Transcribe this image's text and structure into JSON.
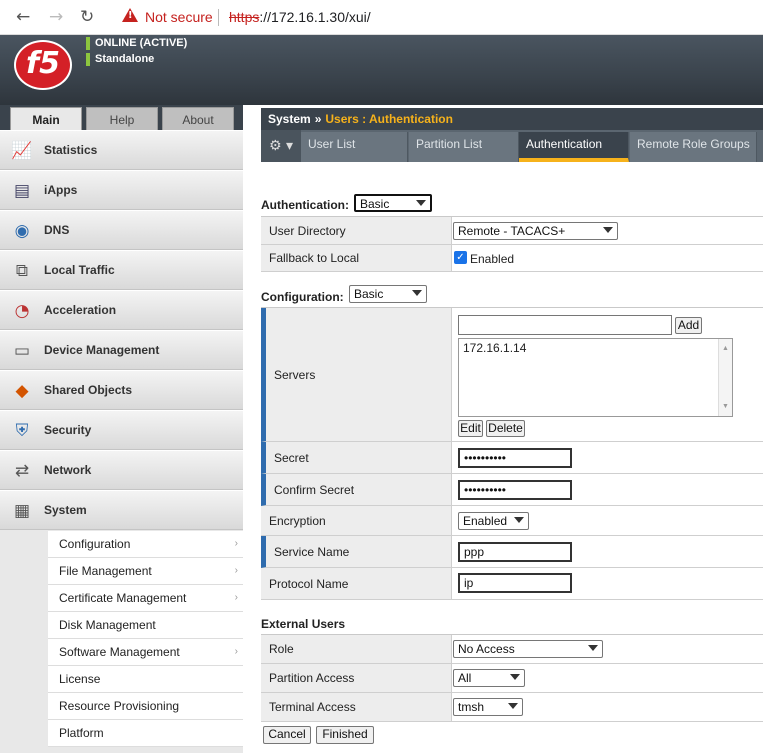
{
  "browser": {
    "security_label": "Not secure",
    "url_scheme": "https",
    "url_rest": "://172.16.1.30/xui/"
  },
  "header": {
    "logo_text": "f5",
    "status": "ONLINE (ACTIVE)",
    "mode": "Standalone"
  },
  "tabs": [
    "Main",
    "Help",
    "About"
  ],
  "nav": [
    {
      "label": "Statistics",
      "icon": "statistics-icon"
    },
    {
      "label": "iApps",
      "icon": "iapps-icon"
    },
    {
      "label": "DNS",
      "icon": "dns-globe-icon"
    },
    {
      "label": "Local Traffic",
      "icon": "local-traffic-icon"
    },
    {
      "label": "Acceleration",
      "icon": "speedometer-icon"
    },
    {
      "label": "Device Management",
      "icon": "device-icon"
    },
    {
      "label": "Shared Objects",
      "icon": "shapes-icon"
    },
    {
      "label": "Security",
      "icon": "shield-icon"
    },
    {
      "label": "Network",
      "icon": "network-icon"
    },
    {
      "label": "System",
      "icon": "system-icon"
    }
  ],
  "subnav": [
    {
      "label": "Configuration",
      "chev": "›"
    },
    {
      "label": "File Management",
      "chev": "›"
    },
    {
      "label": "Certificate Management",
      "chev": "›"
    },
    {
      "label": "Disk Management",
      "chev": ""
    },
    {
      "label": "Software Management",
      "chev": "›"
    },
    {
      "label": "License",
      "chev": ""
    },
    {
      "label": "Resource Provisioning",
      "chev": ""
    },
    {
      "label": "Platform",
      "chev": ""
    }
  ],
  "breadcrumb": {
    "root": "System",
    "sep": "»",
    "current": "Users : Authentication"
  },
  "subtabs": [
    "User List",
    "Partition List",
    "Authentication",
    "Remote Role Groups"
  ],
  "auth": {
    "label": "Authentication:",
    "mode": "Basic",
    "user_directory_label": "User Directory",
    "user_directory_value": "Remote - TACACS+",
    "fallback_label": "Fallback to Local",
    "fallback_value": "Enabled"
  },
  "config": {
    "label": "Configuration:",
    "mode": "Basic",
    "servers_label": "Servers",
    "server_input": "",
    "add_label": "Add",
    "servers": [
      "172.16.1.14"
    ],
    "edit_label": "Edit",
    "delete_label": "Delete",
    "secret_label": "Secret",
    "secret_value": "••••••••••",
    "confirm_label": "Confirm Secret",
    "confirm_value": "••••••••••",
    "encryption_label": "Encryption",
    "encryption_value": "Enabled",
    "service_label": "Service Name",
    "service_value": "ppp",
    "protocol_label": "Protocol Name",
    "protocol_value": "ip"
  },
  "external": {
    "label": "External Users",
    "role_label": "Role",
    "role_value": "No Access",
    "partition_label": "Partition Access",
    "partition_value": "All",
    "terminal_label": "Terminal Access",
    "terminal_value": "tmsh"
  },
  "actions": {
    "cancel": "Cancel",
    "finished": "Finished"
  }
}
